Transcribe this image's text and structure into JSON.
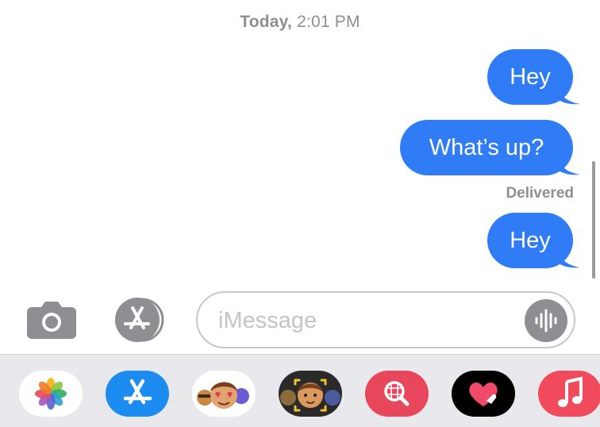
{
  "header": {
    "timestamp_day": "Today,",
    "timestamp_time": "2:01 PM"
  },
  "messages": [
    {
      "text": "Hey"
    },
    {
      "text": "What’s up?"
    },
    {
      "text": "Hey"
    }
  ],
  "delivery_status": "Delivered",
  "composer": {
    "placeholder": "iMessage",
    "camera_icon": "camera-icon",
    "apps_icon": "app-store-icon",
    "audio_icon": "audio-waveform-icon"
  },
  "app_drawer": {
    "apps": [
      {
        "name": "Photos",
        "icon": "photos-icon"
      },
      {
        "name": "App Store",
        "icon": "app-store-icon"
      },
      {
        "name": "Memoji Stickers",
        "icon": "memoji-stickers-icon"
      },
      {
        "name": "Animoji",
        "icon": "animoji-icon"
      },
      {
        "name": "#images",
        "icon": "image-search-icon"
      },
      {
        "name": "Digital Touch",
        "icon": "digital-touch-icon"
      },
      {
        "name": "Music",
        "icon": "music-note-icon"
      }
    ]
  },
  "colors": {
    "bubble_blue": "#2f7cf6",
    "secondary_text": "#8e8e93",
    "tray_background": "#e9e9ed"
  }
}
